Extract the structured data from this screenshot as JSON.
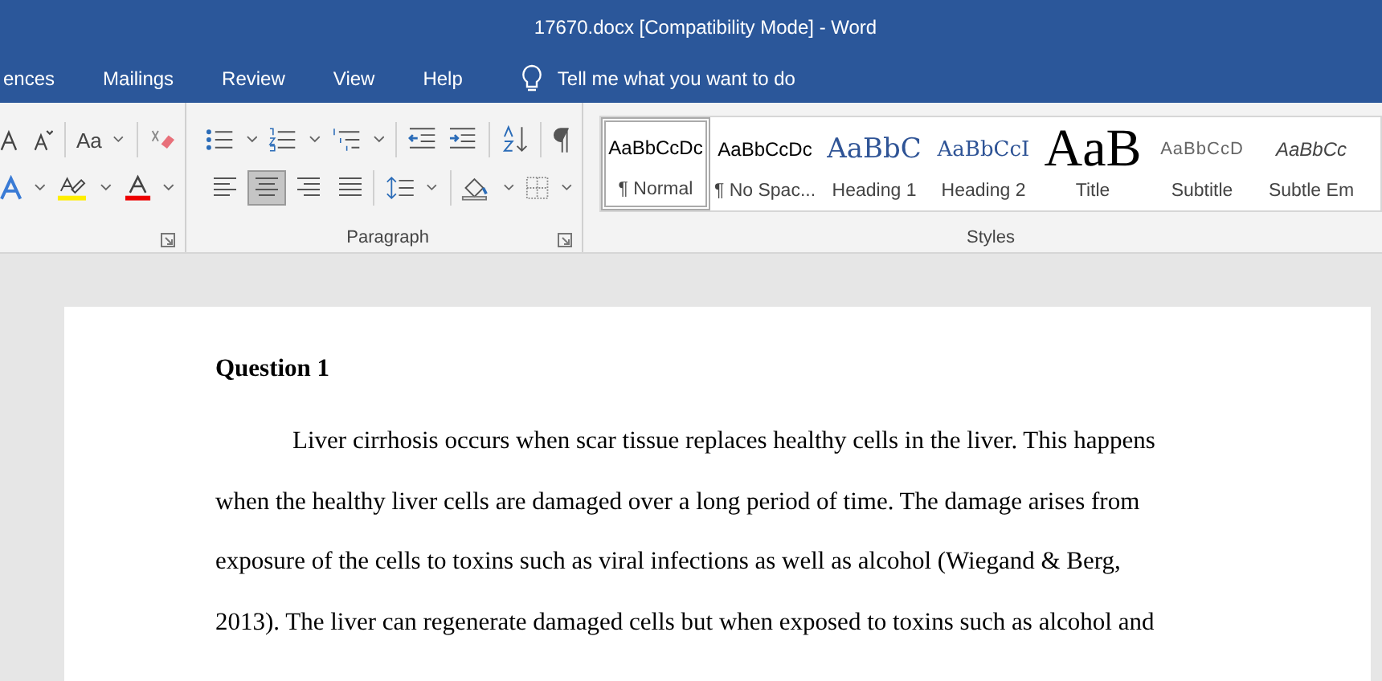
{
  "window": {
    "title": "17670.docx [Compatibility Mode]  -  Word"
  },
  "tabs": [
    {
      "label": "ences",
      "selected": false
    },
    {
      "label": "Mailings",
      "selected": false
    },
    {
      "label": "Review",
      "selected": false
    },
    {
      "label": "View",
      "selected": false
    },
    {
      "label": "Help",
      "selected": false
    }
  ],
  "tell_me": {
    "placeholder": "Tell me what you want to do"
  },
  "font_group": {
    "change_case": "Aa"
  },
  "paragraph_group": {
    "label": "Paragraph",
    "alignments": [
      {
        "kind": "left",
        "selected": false
      },
      {
        "kind": "center",
        "selected": true
      },
      {
        "kind": "right",
        "selected": false
      },
      {
        "kind": "justify",
        "selected": false
      }
    ]
  },
  "styles_group": {
    "label": "Styles",
    "styles": [
      {
        "kind": "normal",
        "preview": "AaBbCcDc",
        "label": "¶ Normal",
        "selected": true
      },
      {
        "kind": "nospacing",
        "preview": "AaBbCcDc",
        "label": "¶ No Spac...",
        "selected": false
      },
      {
        "kind": "heading1",
        "preview": "AaBbC",
        "label": "Heading 1",
        "selected": false
      },
      {
        "kind": "heading2",
        "preview": "AaBbCcI",
        "label": "Heading 2",
        "selected": false
      },
      {
        "kind": "title",
        "preview": "AaB",
        "label": "Title",
        "selected": false
      },
      {
        "kind": "subtitle",
        "preview": "AaBbCcD",
        "label": "Subtitle",
        "selected": false
      },
      {
        "kind": "emphasis",
        "preview": "AaBbCc",
        "label": "Subtle Em",
        "selected": false
      }
    ]
  },
  "document": {
    "heading": "Question 1",
    "paragraph": "Liver cirrhosis occurs when scar tissue replaces healthy cells in the liver. This happens when the healthy liver cells are damaged over a long period of time. The damage arises from exposure of the cells to toxins such as viral infections as well as alcohol (Wiegand & Berg, 2013). The liver can regenerate damaged cells but when exposed to toxins such as alcohol and"
  }
}
